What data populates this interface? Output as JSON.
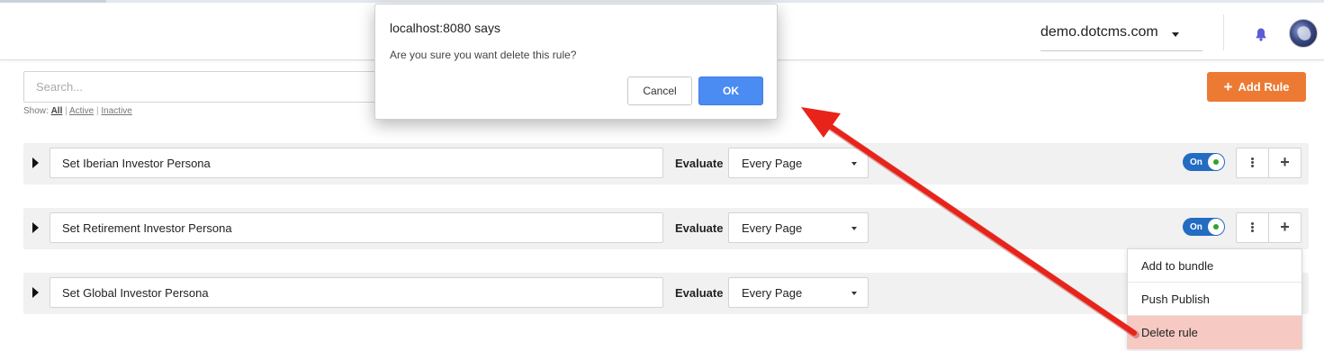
{
  "header": {
    "site_selector": "demo.dotcms.com"
  },
  "search": {
    "placeholder": "Search..."
  },
  "filter": {
    "prefix": "Show:",
    "options": [
      "All",
      "Active",
      "Inactive"
    ],
    "separator": "|",
    "selected": "All"
  },
  "add_rule_button": {
    "label": "Add Rule"
  },
  "rules": [
    {
      "name": "Set Iberian Investor Persona",
      "evaluate_label": "Evaluate",
      "fire_on": "Every Page",
      "toggle": "On",
      "enabled": true
    },
    {
      "name": "Set Retirement Investor Persona",
      "evaluate_label": "Evaluate",
      "fire_on": "Every Page",
      "toggle": "On",
      "enabled": true
    },
    {
      "name": "Set Global Investor Persona",
      "evaluate_label": "Evaluate",
      "fire_on": "Every Page"
    }
  ],
  "rule_menu": {
    "items": [
      "Add to bundle",
      "Push Publish",
      "Delete rule"
    ],
    "highlighted": "Delete rule"
  },
  "dialog": {
    "title": "localhost:8080 says",
    "message": "Are you sure you want delete this rule?",
    "cancel_label": "Cancel",
    "ok_label": "OK"
  },
  "icons": {
    "notifications": "bell-icon",
    "site_dropdown": "caret-down-icon",
    "rule_expand": "triangle-right-icon",
    "rule_actions": "kebab-menu-icon",
    "add_condition": "plus-icon"
  },
  "colors": {
    "accent_orange": "#ec7a32",
    "toggle_blue": "#236cc2",
    "dialog_ok_blue": "#4a8cf2",
    "delete_highlight": "#f6c9c2",
    "annotation_red": "#e8231a"
  }
}
